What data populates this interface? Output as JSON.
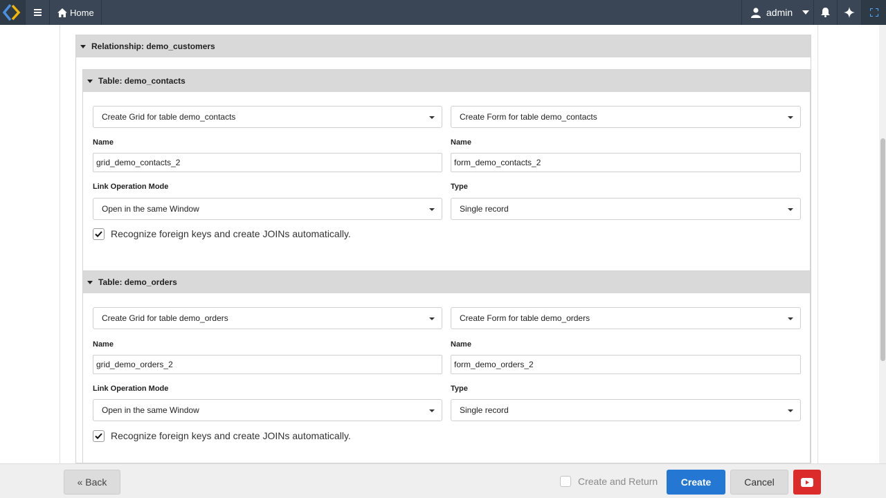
{
  "topbar": {
    "home_label": "Home",
    "user_label": "admin"
  },
  "relationship": {
    "title": "Relationship: demo_customers"
  },
  "tables": [
    {
      "title": "Table: demo_contacts",
      "grid_select": "Create Grid for table demo_contacts",
      "form_select": "Create Form for table demo_contacts",
      "grid_name_label": "Name",
      "grid_name_value": "grid_demo_contacts_2",
      "form_name_label": "Name",
      "form_name_value": "form_demo_contacts_2",
      "link_mode_label": "Link Operation Mode",
      "link_mode_value": "Open in the same Window",
      "type_label": "Type",
      "type_value": "Single record",
      "fk_label": "Recognize foreign keys and create JOINs automatically."
    },
    {
      "title": "Table: demo_orders",
      "grid_select": "Create Grid for table demo_orders",
      "form_select": "Create Form for table demo_orders",
      "grid_name_label": "Name",
      "grid_name_value": "grid_demo_orders_2",
      "form_name_label": "Name",
      "form_name_value": "form_demo_orders_2",
      "link_mode_label": "Link Operation Mode",
      "link_mode_value": "Open in the same Window",
      "type_label": "Type",
      "type_value": "Single record",
      "fk_label": "Recognize foreign keys and create JOINs automatically."
    }
  ],
  "footer": {
    "back_label": "« Back",
    "create_return_label": "Create and Return",
    "create_label": "Create",
    "cancel_label": "Cancel"
  },
  "colors": {
    "topbar": "#3a4655",
    "primary": "#2477d2",
    "danger": "#dc2b2b",
    "logo_blue": "#4a90e2",
    "logo_yellow": "#f2b705"
  },
  "icons": [
    "logo-icon",
    "menu-icon",
    "home-icon",
    "user-icon",
    "chevron-down-icon",
    "bell-icon",
    "sparkle-icon",
    "fullscreen-icon",
    "checkmark-icon",
    "youtube-play-icon"
  ]
}
